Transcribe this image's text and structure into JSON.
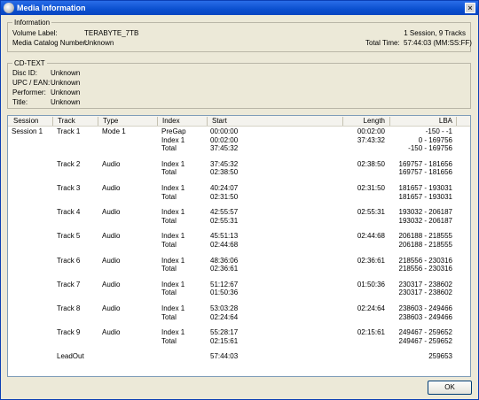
{
  "window": {
    "title": "Media Information",
    "close_glyph": "×"
  },
  "information": {
    "group_label": "Information",
    "volume_label_caption": "Volume Label:",
    "volume_label_value": "TERABYTE_7TB",
    "catalog_caption": "Media Catalog Number:",
    "catalog_value": "Unknown",
    "sessions_tracks": "1 Session, 9 Tracks",
    "total_time_caption": "Total Time:",
    "total_time_value": "57:44:03 (MM:SS:FF)"
  },
  "cdtext": {
    "group_label": "CD-TEXT",
    "fields": [
      {
        "caption": "Disc ID:",
        "value": "Unknown"
      },
      {
        "caption": "UPC / EAN:",
        "value": "Unknown"
      },
      {
        "caption": "Performer:",
        "value": "Unknown"
      },
      {
        "caption": "Title:",
        "value": "Unknown"
      }
    ]
  },
  "table": {
    "columns": [
      "Session",
      "Track",
      "Type",
      "Index",
      "Start",
      "Length",
      "LBA"
    ],
    "rows": [
      {
        "session": "Session 1",
        "track": "Track 1",
        "type": "Mode 1",
        "index": "PreGap",
        "start": "00:00:00",
        "length": "00:02:00",
        "lba": "-150 - -1"
      },
      {
        "session": "",
        "track": "",
        "type": "",
        "index": "Index 1",
        "start": "00:02:00",
        "length": "37:43:32",
        "lba": "0 - 169756"
      },
      {
        "session": "",
        "track": "",
        "type": "",
        "index": "Total",
        "start": "37:45:32",
        "length": "",
        "lba": "-150 - 169756"
      },
      {
        "session": "",
        "track": "Track 2",
        "type": "Audio",
        "index": "Index 1",
        "start": "37:45:32",
        "length": "02:38:50",
        "lba": "169757 - 181656"
      },
      {
        "session": "",
        "track": "",
        "type": "",
        "index": "Total",
        "start": "02:38:50",
        "length": "",
        "lba": "169757 - 181656"
      },
      {
        "session": "",
        "track": "Track 3",
        "type": "Audio",
        "index": "Index 1",
        "start": "40:24:07",
        "length": "02:31:50",
        "lba": "181657 - 193031"
      },
      {
        "session": "",
        "track": "",
        "type": "",
        "index": "Total",
        "start": "02:31:50",
        "length": "",
        "lba": "181657 - 193031"
      },
      {
        "session": "",
        "track": "Track 4",
        "type": "Audio",
        "index": "Index 1",
        "start": "42:55:57",
        "length": "02:55:31",
        "lba": "193032 - 206187"
      },
      {
        "session": "",
        "track": "",
        "type": "",
        "index": "Total",
        "start": "02:55:31",
        "length": "",
        "lba": "193032 - 206187"
      },
      {
        "session": "",
        "track": "Track 5",
        "type": "Audio",
        "index": "Index 1",
        "start": "45:51:13",
        "length": "02:44:68",
        "lba": "206188 - 218555"
      },
      {
        "session": "",
        "track": "",
        "type": "",
        "index": "Total",
        "start": "02:44:68",
        "length": "",
        "lba": "206188 - 218555"
      },
      {
        "session": "",
        "track": "Track 6",
        "type": "Audio",
        "index": "Index 1",
        "start": "48:36:06",
        "length": "02:36:61",
        "lba": "218556 - 230316"
      },
      {
        "session": "",
        "track": "",
        "type": "",
        "index": "Total",
        "start": "02:36:61",
        "length": "",
        "lba": "218556 - 230316"
      },
      {
        "session": "",
        "track": "Track 7",
        "type": "Audio",
        "index": "Index 1",
        "start": "51:12:67",
        "length": "01:50:36",
        "lba": "230317 - 238602"
      },
      {
        "session": "",
        "track": "",
        "type": "",
        "index": "Total",
        "start": "01:50:36",
        "length": "",
        "lba": "230317 - 238602"
      },
      {
        "session": "",
        "track": "Track 8",
        "type": "Audio",
        "index": "Index 1",
        "start": "53:03:28",
        "length": "02:24:64",
        "lba": "238603 - 249466"
      },
      {
        "session": "",
        "track": "",
        "type": "",
        "index": "Total",
        "start": "02:24:64",
        "length": "",
        "lba": "238603 - 249466"
      },
      {
        "session": "",
        "track": "Track 9",
        "type": "Audio",
        "index": "Index 1",
        "start": "55:28:17",
        "length": "02:15:61",
        "lba": "249467 - 259652"
      },
      {
        "session": "",
        "track": "",
        "type": "",
        "index": "Total",
        "start": "02:15:61",
        "length": "",
        "lba": "249467 - 259652"
      },
      {
        "session": "",
        "track": "LeadOut",
        "type": "",
        "index": "",
        "start": "57:44:03",
        "length": "",
        "lba": "259653"
      }
    ]
  },
  "buttons": {
    "ok": "OK"
  }
}
